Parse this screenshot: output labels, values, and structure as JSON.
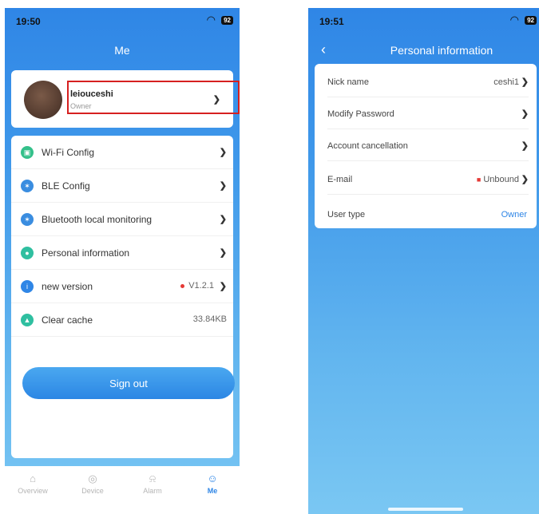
{
  "left": {
    "status_time": "19:50",
    "battery": "92",
    "title": "Me",
    "profile": {
      "name": "leiouceshi",
      "role": "Owner"
    },
    "menu": [
      {
        "label": "Wi-Fi Config",
        "icon": "wifi-config-icon",
        "color": "#34c08a"
      },
      {
        "label": "BLE Config",
        "icon": "ble-icon",
        "color": "#3a8de0"
      },
      {
        "label": "Bluetooth local monitoring",
        "icon": "bluetooth-monitor-icon",
        "color": "#3a8de0"
      },
      {
        "label": "Personal information",
        "icon": "person-icon",
        "color": "#2fbfa0"
      },
      {
        "label": "new version",
        "icon": "info-icon",
        "color": "#2f86e6",
        "value": "V1.2.1"
      },
      {
        "label": "Clear cache",
        "icon": "broom-icon",
        "color": "#2fbfa0",
        "value": "33.84KB"
      }
    ],
    "sign_out": "Sign out",
    "tabs": [
      "Overview",
      "Device",
      "Alarm",
      "Me"
    ]
  },
  "right": {
    "status_time": "19:51",
    "battery": "92",
    "title": "Personal information",
    "rows": [
      {
        "label": "Nick name",
        "value": "ceshi1"
      },
      {
        "label": "Modify Password",
        "value": ""
      },
      {
        "label": "Account cancellation",
        "value": ""
      },
      {
        "label": "E-mail",
        "value": "Unbound"
      },
      {
        "label": "User type",
        "value": "Owner"
      }
    ]
  },
  "colors": {
    "accent": "#2f86e6",
    "highlight": "#d62020",
    "warning": "#e53935"
  }
}
